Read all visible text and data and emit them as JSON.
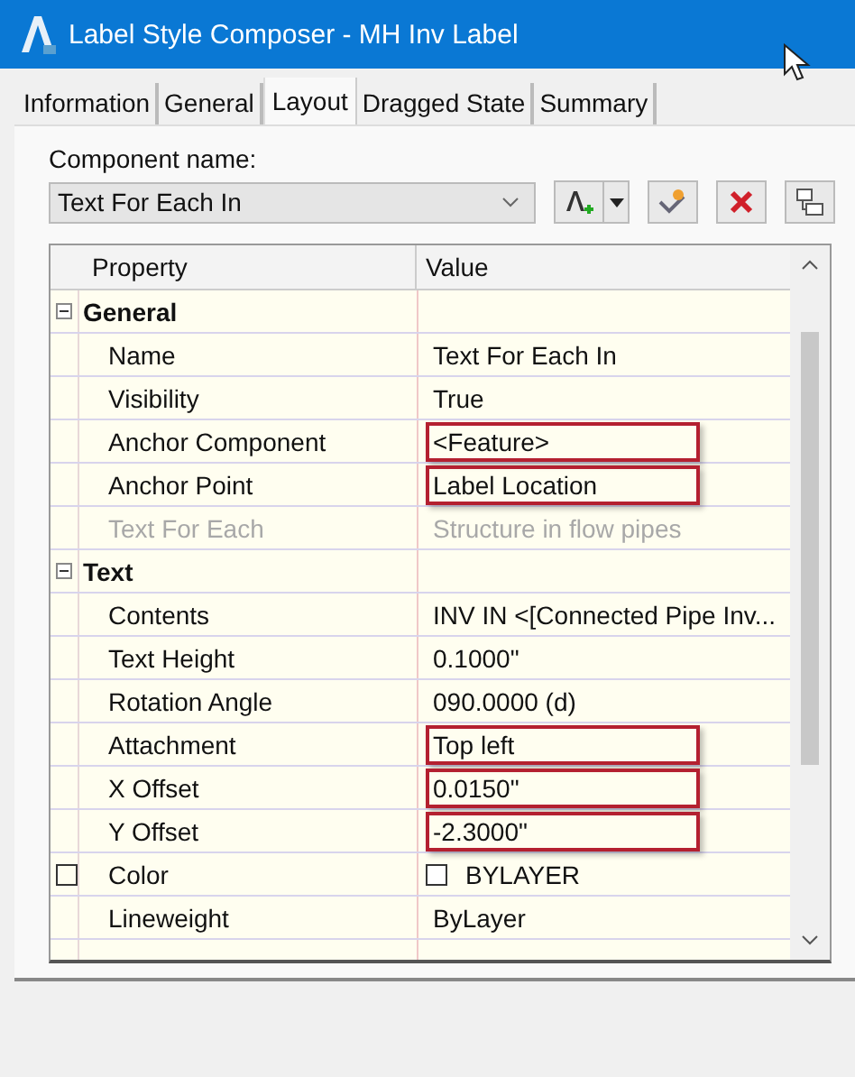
{
  "window": {
    "title": "Label Style Composer - MH Inv Label"
  },
  "tabs": [
    {
      "label": "Information",
      "selected": false
    },
    {
      "label": "General",
      "selected": false
    },
    {
      "label": "Layout",
      "selected": true
    },
    {
      "label": "Dragged State",
      "selected": false
    },
    {
      "label": "Summary",
      "selected": false
    }
  ],
  "component": {
    "label": "Component name:",
    "value": "Text For Each In"
  },
  "grid": {
    "columns": [
      "Property",
      "Value"
    ],
    "groups": [
      {
        "name": "General",
        "expanded": true,
        "rows": [
          {
            "kind": "text",
            "property": "Name",
            "value": "Text For Each In",
            "highlighted": false,
            "disabled": false
          },
          {
            "kind": "text",
            "property": "Visibility",
            "value": "True",
            "highlighted": false,
            "disabled": false
          },
          {
            "kind": "text",
            "property": "Anchor Component",
            "value": "<Feature>",
            "highlighted": true,
            "disabled": false
          },
          {
            "kind": "text",
            "property": "Anchor Point",
            "value": "Label Location",
            "highlighted": true,
            "disabled": false
          },
          {
            "kind": "text",
            "property": "Text For Each",
            "value": "Structure in flow pipes",
            "highlighted": false,
            "disabled": true
          }
        ]
      },
      {
        "name": "Text",
        "expanded": true,
        "rows": [
          {
            "kind": "text",
            "property": "Contents",
            "value": "INV IN <[Connected Pipe Inv...",
            "highlighted": false,
            "disabled": false
          },
          {
            "kind": "text",
            "property": "Text Height",
            "value": "0.1000\"",
            "highlighted": false,
            "disabled": false
          },
          {
            "kind": "text",
            "property": "Rotation Angle",
            "value": "090.0000 (d)",
            "highlighted": false,
            "disabled": false
          },
          {
            "kind": "text",
            "property": "Attachment",
            "value": "Top left",
            "highlighted": true,
            "disabled": false
          },
          {
            "kind": "text",
            "property": "X Offset",
            "value": "0.0150\"",
            "highlighted": true,
            "disabled": false
          },
          {
            "kind": "text",
            "property": "Y Offset",
            "value": "-2.3000\"",
            "highlighted": true,
            "disabled": false
          },
          {
            "kind": "color",
            "property": "Color",
            "value": "BYLAYER",
            "highlighted": false,
            "disabled": false,
            "color": "#ffffff"
          },
          {
            "kind": "text",
            "property": "Lineweight",
            "value": "ByLayer",
            "highlighted": false,
            "disabled": false
          }
        ]
      }
    ]
  }
}
